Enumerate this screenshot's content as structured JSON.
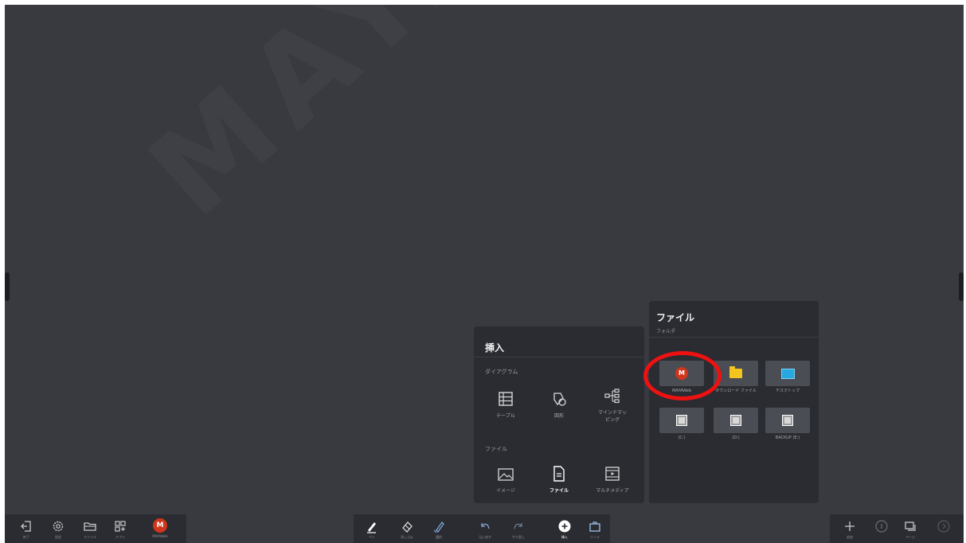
{
  "watermark": "MAYA ST",
  "insert_panel": {
    "title": "挿入",
    "diagram_section": "ダイアグラム",
    "diagram_items": [
      {
        "label": "テーブル"
      },
      {
        "label": "図形"
      },
      {
        "label": "マインドマッ\nピング"
      }
    ],
    "file_section": "ファイル",
    "file_items": [
      {
        "label": "イメージ"
      },
      {
        "label": "ファイル"
      },
      {
        "label": "マルチメディア"
      }
    ]
  },
  "file_panel": {
    "title": "ファイル",
    "subtitle": "フォルダ",
    "tiles": [
      {
        "label": "MAYAWeb",
        "icon": "maya-logo-icon"
      },
      {
        "label": "ダウンロード ファイル",
        "icon": "folder-icon"
      },
      {
        "label": "デスクトップ",
        "icon": "monitor-icon"
      },
      {
        "label": "(C:)",
        "icon": "drive-icon"
      },
      {
        "label": "(D:)",
        "icon": "drive-icon"
      },
      {
        "label": "BACKUP (E:)",
        "icon": "drive-icon"
      }
    ]
  },
  "toolbar_left": {
    "items": [
      {
        "label": "終了",
        "icon": "exit-icon"
      },
      {
        "label": "設定",
        "icon": "gear-icon"
      },
      {
        "label": "ファイル",
        "icon": "folder-icon"
      },
      {
        "label": "アプリ",
        "icon": "apps-icon"
      },
      {
        "label": "MAYAWeb",
        "icon": "maya-logo-icon"
      }
    ],
    "maya_letter": "M"
  },
  "toolbar_center": {
    "items": [
      {
        "label": "ペン",
        "icon": "pen-icon"
      },
      {
        "label": "消しゴム",
        "icon": "eraser-icon"
      },
      {
        "label": "選択",
        "icon": "select-icon"
      },
      {
        "label": "元に戻す",
        "icon": "undo-icon"
      },
      {
        "label": "やり直し",
        "icon": "redo-icon"
      },
      {
        "label": "挿入",
        "icon": "plus-circle-icon"
      },
      {
        "label": "ツール",
        "icon": "toolbox-icon"
      }
    ]
  },
  "toolbar_right": {
    "items": [
      {
        "label": "追加",
        "icon": "add-page-icon"
      },
      {
        "label": "",
        "icon": "page-indicator-icon"
      },
      {
        "label": "ページ",
        "icon": "pages-icon"
      },
      {
        "label": "",
        "icon": "next-page-icon"
      }
    ]
  },
  "colors": {
    "board": "#383a40",
    "panel": "#2a2c31",
    "tile": "#4a4d54",
    "maya_red": "#d0361c",
    "folder_yellow": "#f3c51e",
    "monitor_blue": "#28a8e0",
    "highlight": "#ee1111"
  }
}
